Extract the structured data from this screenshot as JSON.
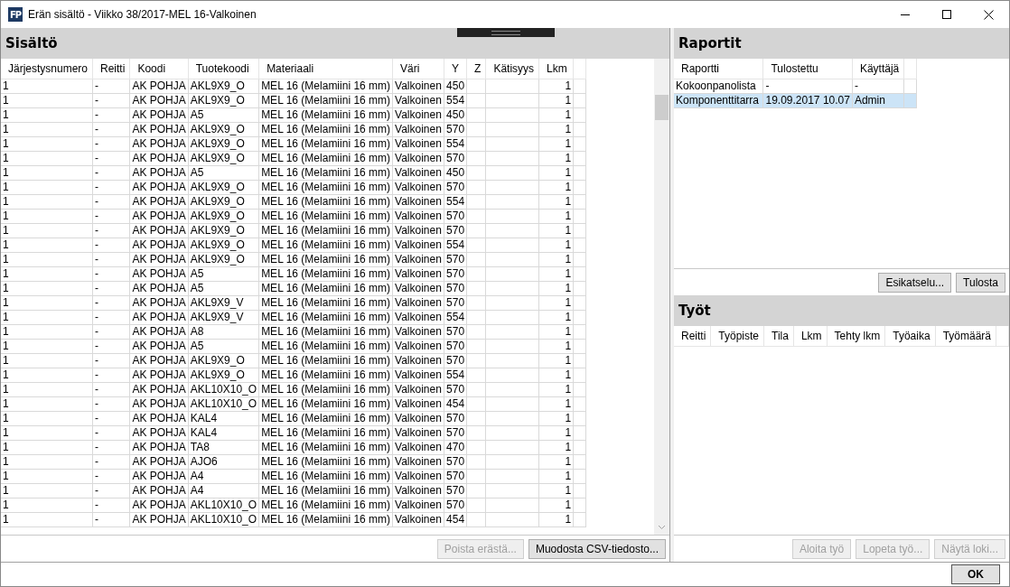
{
  "window": {
    "logo": "FP",
    "title": "Erän sisältö - Viikko 38/2017-MEL 16-Valkoinen"
  },
  "contents": {
    "title": "Sisältö",
    "columns": [
      "Järjestysnumero",
      "Reitti",
      "Koodi",
      "Tuotekoodi",
      "Materiaali",
      "Väri",
      "Y",
      "Z",
      "Kätisyys",
      "Lkm"
    ],
    "rows": [
      [
        "1",
        "-",
        "AK POHJA",
        "AKL9X9_O",
        "MEL 16 (Melamiini 16 mm)",
        "Valkoinen",
        "450",
        null,
        null,
        "1"
      ],
      [
        "1",
        "-",
        "AK POHJA",
        "AKL9X9_O",
        "MEL 16 (Melamiini 16 mm)",
        "Valkoinen",
        "554",
        null,
        null,
        "1"
      ],
      [
        "1",
        "-",
        "AK POHJA",
        "A5",
        "MEL 16 (Melamiini 16 mm)",
        "Valkoinen",
        "450",
        null,
        null,
        "1"
      ],
      [
        "1",
        "-",
        "AK POHJA",
        "AKL9X9_O",
        "MEL 16 (Melamiini 16 mm)",
        "Valkoinen",
        "570",
        null,
        null,
        "1"
      ],
      [
        "1",
        "-",
        "AK POHJA",
        "AKL9X9_O",
        "MEL 16 (Melamiini 16 mm)",
        "Valkoinen",
        "554",
        null,
        null,
        "1"
      ],
      [
        "1",
        "-",
        "AK POHJA",
        "AKL9X9_O",
        "MEL 16 (Melamiini 16 mm)",
        "Valkoinen",
        "570",
        null,
        null,
        "1"
      ],
      [
        "1",
        "-",
        "AK POHJA",
        "A5",
        "MEL 16 (Melamiini 16 mm)",
        "Valkoinen",
        "450",
        null,
        null,
        "1"
      ],
      [
        "1",
        "-",
        "AK POHJA",
        "AKL9X9_O",
        "MEL 16 (Melamiini 16 mm)",
        "Valkoinen",
        "570",
        null,
        null,
        "1"
      ],
      [
        "1",
        "-",
        "AK POHJA",
        "AKL9X9_O",
        "MEL 16 (Melamiini 16 mm)",
        "Valkoinen",
        "554",
        null,
        null,
        "1"
      ],
      [
        "1",
        "-",
        "AK POHJA",
        "AKL9X9_O",
        "MEL 16 (Melamiini 16 mm)",
        "Valkoinen",
        "570",
        null,
        null,
        "1"
      ],
      [
        "1",
        "-",
        "AK POHJA",
        "AKL9X9_O",
        "MEL 16 (Melamiini 16 mm)",
        "Valkoinen",
        "570",
        null,
        null,
        "1"
      ],
      [
        "1",
        "-",
        "AK POHJA",
        "AKL9X9_O",
        "MEL 16 (Melamiini 16 mm)",
        "Valkoinen",
        "554",
        null,
        null,
        "1"
      ],
      [
        "1",
        "-",
        "AK POHJA",
        "AKL9X9_O",
        "MEL 16 (Melamiini 16 mm)",
        "Valkoinen",
        "570",
        null,
        null,
        "1"
      ],
      [
        "1",
        "-",
        "AK POHJA",
        "A5",
        "MEL 16 (Melamiini 16 mm)",
        "Valkoinen",
        "570",
        null,
        null,
        "1"
      ],
      [
        "1",
        "-",
        "AK POHJA",
        "A5",
        "MEL 16 (Melamiini 16 mm)",
        "Valkoinen",
        "570",
        null,
        null,
        "1"
      ],
      [
        "1",
        "-",
        "AK POHJA",
        "AKL9X9_V",
        "MEL 16 (Melamiini 16 mm)",
        "Valkoinen",
        "570",
        null,
        null,
        "1"
      ],
      [
        "1",
        "-",
        "AK POHJA",
        "AKL9X9_V",
        "MEL 16 (Melamiini 16 mm)",
        "Valkoinen",
        "554",
        null,
        null,
        "1"
      ],
      [
        "1",
        "-",
        "AK POHJA",
        "A8",
        "MEL 16 (Melamiini 16 mm)",
        "Valkoinen",
        "570",
        null,
        null,
        "1"
      ],
      [
        "1",
        "-",
        "AK POHJA",
        "A5",
        "MEL 16 (Melamiini 16 mm)",
        "Valkoinen",
        "570",
        null,
        null,
        "1"
      ],
      [
        "1",
        "-",
        "AK POHJA",
        "AKL9X9_O",
        "MEL 16 (Melamiini 16 mm)",
        "Valkoinen",
        "570",
        null,
        null,
        "1"
      ],
      [
        "1",
        "-",
        "AK POHJA",
        "AKL9X9_O",
        "MEL 16 (Melamiini 16 mm)",
        "Valkoinen",
        "554",
        null,
        null,
        "1"
      ],
      [
        "1",
        "-",
        "AK POHJA",
        "AKL10X10_O",
        "MEL 16 (Melamiini 16 mm)",
        "Valkoinen",
        "570",
        null,
        null,
        "1"
      ],
      [
        "1",
        "-",
        "AK POHJA",
        "AKL10X10_O",
        "MEL 16 (Melamiini 16 mm)",
        "Valkoinen",
        "454",
        null,
        null,
        "1"
      ],
      [
        "1",
        "-",
        "AK POHJA",
        "KAL4",
        "MEL 16 (Melamiini 16 mm)",
        "Valkoinen",
        "570",
        null,
        null,
        "1"
      ],
      [
        "1",
        "-",
        "AK POHJA",
        "KAL4",
        "MEL 16 (Melamiini 16 mm)",
        "Valkoinen",
        "570",
        null,
        null,
        "1"
      ],
      [
        "1",
        "-",
        "AK POHJA",
        "TA8",
        "MEL 16 (Melamiini 16 mm)",
        "Valkoinen",
        "470",
        null,
        null,
        "1"
      ],
      [
        "1",
        "-",
        "AK POHJA",
        "AJO6",
        "MEL 16 (Melamiini 16 mm)",
        "Valkoinen",
        "570",
        null,
        null,
        "1"
      ],
      [
        "1",
        "-",
        "AK POHJA",
        "A4",
        "MEL 16 (Melamiini 16 mm)",
        "Valkoinen",
        "570",
        null,
        null,
        "1"
      ],
      [
        "1",
        "-",
        "AK POHJA",
        "A4",
        "MEL 16 (Melamiini 16 mm)",
        "Valkoinen",
        "570",
        null,
        null,
        "1"
      ],
      [
        "1",
        "-",
        "AK POHJA",
        "AKL10X10_O",
        "MEL 16 (Melamiini 16 mm)",
        "Valkoinen",
        "570",
        null,
        null,
        "1"
      ],
      [
        "1",
        "-",
        "AK POHJA",
        "AKL10X10_O",
        "MEL 16 (Melamiini 16 mm)",
        "Valkoinen",
        "454",
        null,
        null,
        "1"
      ]
    ],
    "buttons": [
      {
        "label": "Poista erästä...",
        "disabled": true
      },
      {
        "label": "Muodosta CSV-tiedosto...",
        "disabled": false
      }
    ]
  },
  "reports": {
    "title": "Raportit",
    "columns": [
      "Raportti",
      "Tulostettu",
      "Käyttäjä"
    ],
    "rows": [
      {
        "cells": [
          "Kokoonpanolista",
          "-",
          "-"
        ],
        "selected": false
      },
      {
        "cells": [
          "Komponenttitarra",
          "19.09.2017 10.07",
          "Admin"
        ],
        "selected": true
      }
    ],
    "buttons": [
      {
        "label": "Esikatselu...",
        "disabled": false
      },
      {
        "label": "Tulosta",
        "disabled": false
      }
    ]
  },
  "jobs": {
    "title": "Työt",
    "columns": [
      "Reitti",
      "Työpiste",
      "Tila",
      "Lkm",
      "Tehty lkm",
      "Työaika",
      "Työmäärä"
    ],
    "buttons": [
      {
        "label": "Aloita työ",
        "disabled": true
      },
      {
        "label": "Lopeta työ...",
        "disabled": true
      },
      {
        "label": "Näytä loki...",
        "disabled": true
      }
    ]
  },
  "footer": {
    "ok_button": "OK"
  }
}
